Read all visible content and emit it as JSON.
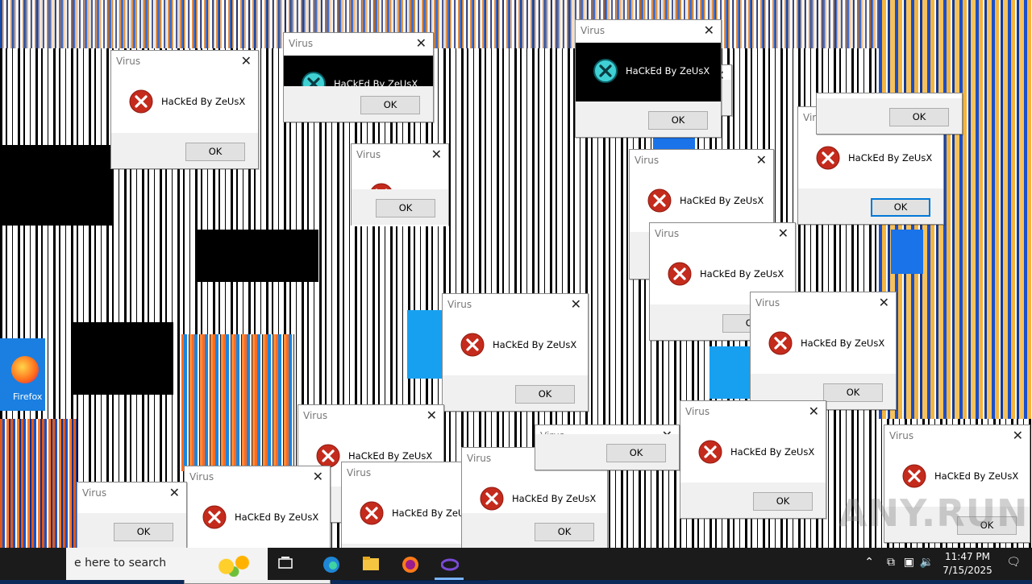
{
  "dialog": {
    "title": "Virus",
    "message": "HaCkEd By ZeUsX",
    "ok_label": "OK",
    "close_glyph": "✕",
    "icon": "error-icon"
  },
  "desktop": {
    "firefox_label": "Firefox",
    "watermark": "ANY.RUN"
  },
  "taskbar": {
    "search_placeholder": "e here to search",
    "time": "11:47 PM",
    "date": "7/15/2025",
    "apps": [
      "task-view-icon",
      "edge-icon",
      "file-explorer-icon",
      "firefox-icon",
      "app-icon"
    ]
  },
  "colors": {
    "error_red": "#c42b1c",
    "taskbar": "#1b1b1b",
    "accent": "#0078d7"
  }
}
